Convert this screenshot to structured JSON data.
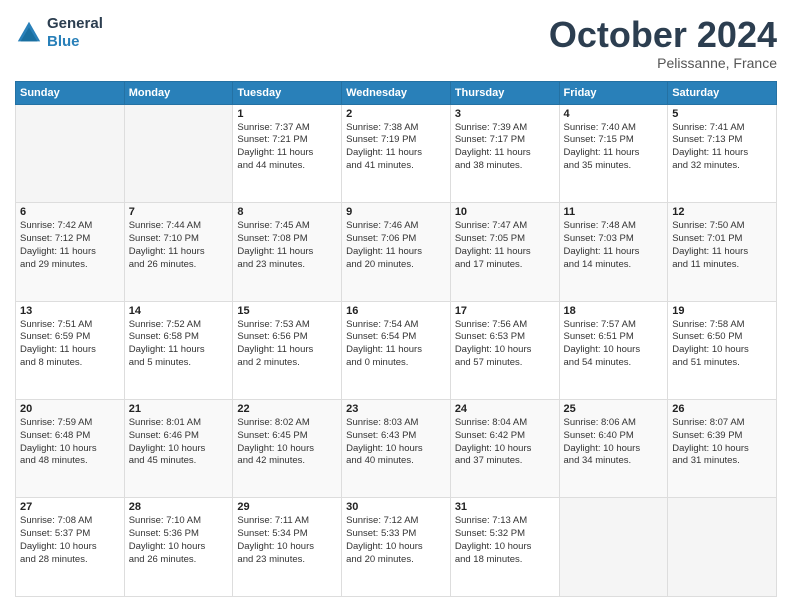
{
  "header": {
    "logo_line1": "General",
    "logo_line2": "Blue",
    "month": "October 2024",
    "location": "Pelissanne, France"
  },
  "weekdays": [
    "Sunday",
    "Monday",
    "Tuesday",
    "Wednesday",
    "Thursday",
    "Friday",
    "Saturday"
  ],
  "weeks": [
    [
      {
        "day": "",
        "detail": ""
      },
      {
        "day": "",
        "detail": ""
      },
      {
        "day": "1",
        "detail": "Sunrise: 7:37 AM\nSunset: 7:21 PM\nDaylight: 11 hours\nand 44 minutes."
      },
      {
        "day": "2",
        "detail": "Sunrise: 7:38 AM\nSunset: 7:19 PM\nDaylight: 11 hours\nand 41 minutes."
      },
      {
        "day": "3",
        "detail": "Sunrise: 7:39 AM\nSunset: 7:17 PM\nDaylight: 11 hours\nand 38 minutes."
      },
      {
        "day": "4",
        "detail": "Sunrise: 7:40 AM\nSunset: 7:15 PM\nDaylight: 11 hours\nand 35 minutes."
      },
      {
        "day": "5",
        "detail": "Sunrise: 7:41 AM\nSunset: 7:13 PM\nDaylight: 11 hours\nand 32 minutes."
      }
    ],
    [
      {
        "day": "6",
        "detail": "Sunrise: 7:42 AM\nSunset: 7:12 PM\nDaylight: 11 hours\nand 29 minutes."
      },
      {
        "day": "7",
        "detail": "Sunrise: 7:44 AM\nSunset: 7:10 PM\nDaylight: 11 hours\nand 26 minutes."
      },
      {
        "day": "8",
        "detail": "Sunrise: 7:45 AM\nSunset: 7:08 PM\nDaylight: 11 hours\nand 23 minutes."
      },
      {
        "day": "9",
        "detail": "Sunrise: 7:46 AM\nSunset: 7:06 PM\nDaylight: 11 hours\nand 20 minutes."
      },
      {
        "day": "10",
        "detail": "Sunrise: 7:47 AM\nSunset: 7:05 PM\nDaylight: 11 hours\nand 17 minutes."
      },
      {
        "day": "11",
        "detail": "Sunrise: 7:48 AM\nSunset: 7:03 PM\nDaylight: 11 hours\nand 14 minutes."
      },
      {
        "day": "12",
        "detail": "Sunrise: 7:50 AM\nSunset: 7:01 PM\nDaylight: 11 hours\nand 11 minutes."
      }
    ],
    [
      {
        "day": "13",
        "detail": "Sunrise: 7:51 AM\nSunset: 6:59 PM\nDaylight: 11 hours\nand 8 minutes."
      },
      {
        "day": "14",
        "detail": "Sunrise: 7:52 AM\nSunset: 6:58 PM\nDaylight: 11 hours\nand 5 minutes."
      },
      {
        "day": "15",
        "detail": "Sunrise: 7:53 AM\nSunset: 6:56 PM\nDaylight: 11 hours\nand 2 minutes."
      },
      {
        "day": "16",
        "detail": "Sunrise: 7:54 AM\nSunset: 6:54 PM\nDaylight: 11 hours\nand 0 minutes."
      },
      {
        "day": "17",
        "detail": "Sunrise: 7:56 AM\nSunset: 6:53 PM\nDaylight: 10 hours\nand 57 minutes."
      },
      {
        "day": "18",
        "detail": "Sunrise: 7:57 AM\nSunset: 6:51 PM\nDaylight: 10 hours\nand 54 minutes."
      },
      {
        "day": "19",
        "detail": "Sunrise: 7:58 AM\nSunset: 6:50 PM\nDaylight: 10 hours\nand 51 minutes."
      }
    ],
    [
      {
        "day": "20",
        "detail": "Sunrise: 7:59 AM\nSunset: 6:48 PM\nDaylight: 10 hours\nand 48 minutes."
      },
      {
        "day": "21",
        "detail": "Sunrise: 8:01 AM\nSunset: 6:46 PM\nDaylight: 10 hours\nand 45 minutes."
      },
      {
        "day": "22",
        "detail": "Sunrise: 8:02 AM\nSunset: 6:45 PM\nDaylight: 10 hours\nand 42 minutes."
      },
      {
        "day": "23",
        "detail": "Sunrise: 8:03 AM\nSunset: 6:43 PM\nDaylight: 10 hours\nand 40 minutes."
      },
      {
        "day": "24",
        "detail": "Sunrise: 8:04 AM\nSunset: 6:42 PM\nDaylight: 10 hours\nand 37 minutes."
      },
      {
        "day": "25",
        "detail": "Sunrise: 8:06 AM\nSunset: 6:40 PM\nDaylight: 10 hours\nand 34 minutes."
      },
      {
        "day": "26",
        "detail": "Sunrise: 8:07 AM\nSunset: 6:39 PM\nDaylight: 10 hours\nand 31 minutes."
      }
    ],
    [
      {
        "day": "27",
        "detail": "Sunrise: 7:08 AM\nSunset: 5:37 PM\nDaylight: 10 hours\nand 28 minutes."
      },
      {
        "day": "28",
        "detail": "Sunrise: 7:10 AM\nSunset: 5:36 PM\nDaylight: 10 hours\nand 26 minutes."
      },
      {
        "day": "29",
        "detail": "Sunrise: 7:11 AM\nSunset: 5:34 PM\nDaylight: 10 hours\nand 23 minutes."
      },
      {
        "day": "30",
        "detail": "Sunrise: 7:12 AM\nSunset: 5:33 PM\nDaylight: 10 hours\nand 20 minutes."
      },
      {
        "day": "31",
        "detail": "Sunrise: 7:13 AM\nSunset: 5:32 PM\nDaylight: 10 hours\nand 18 minutes."
      },
      {
        "day": "",
        "detail": ""
      },
      {
        "day": "",
        "detail": ""
      }
    ]
  ]
}
